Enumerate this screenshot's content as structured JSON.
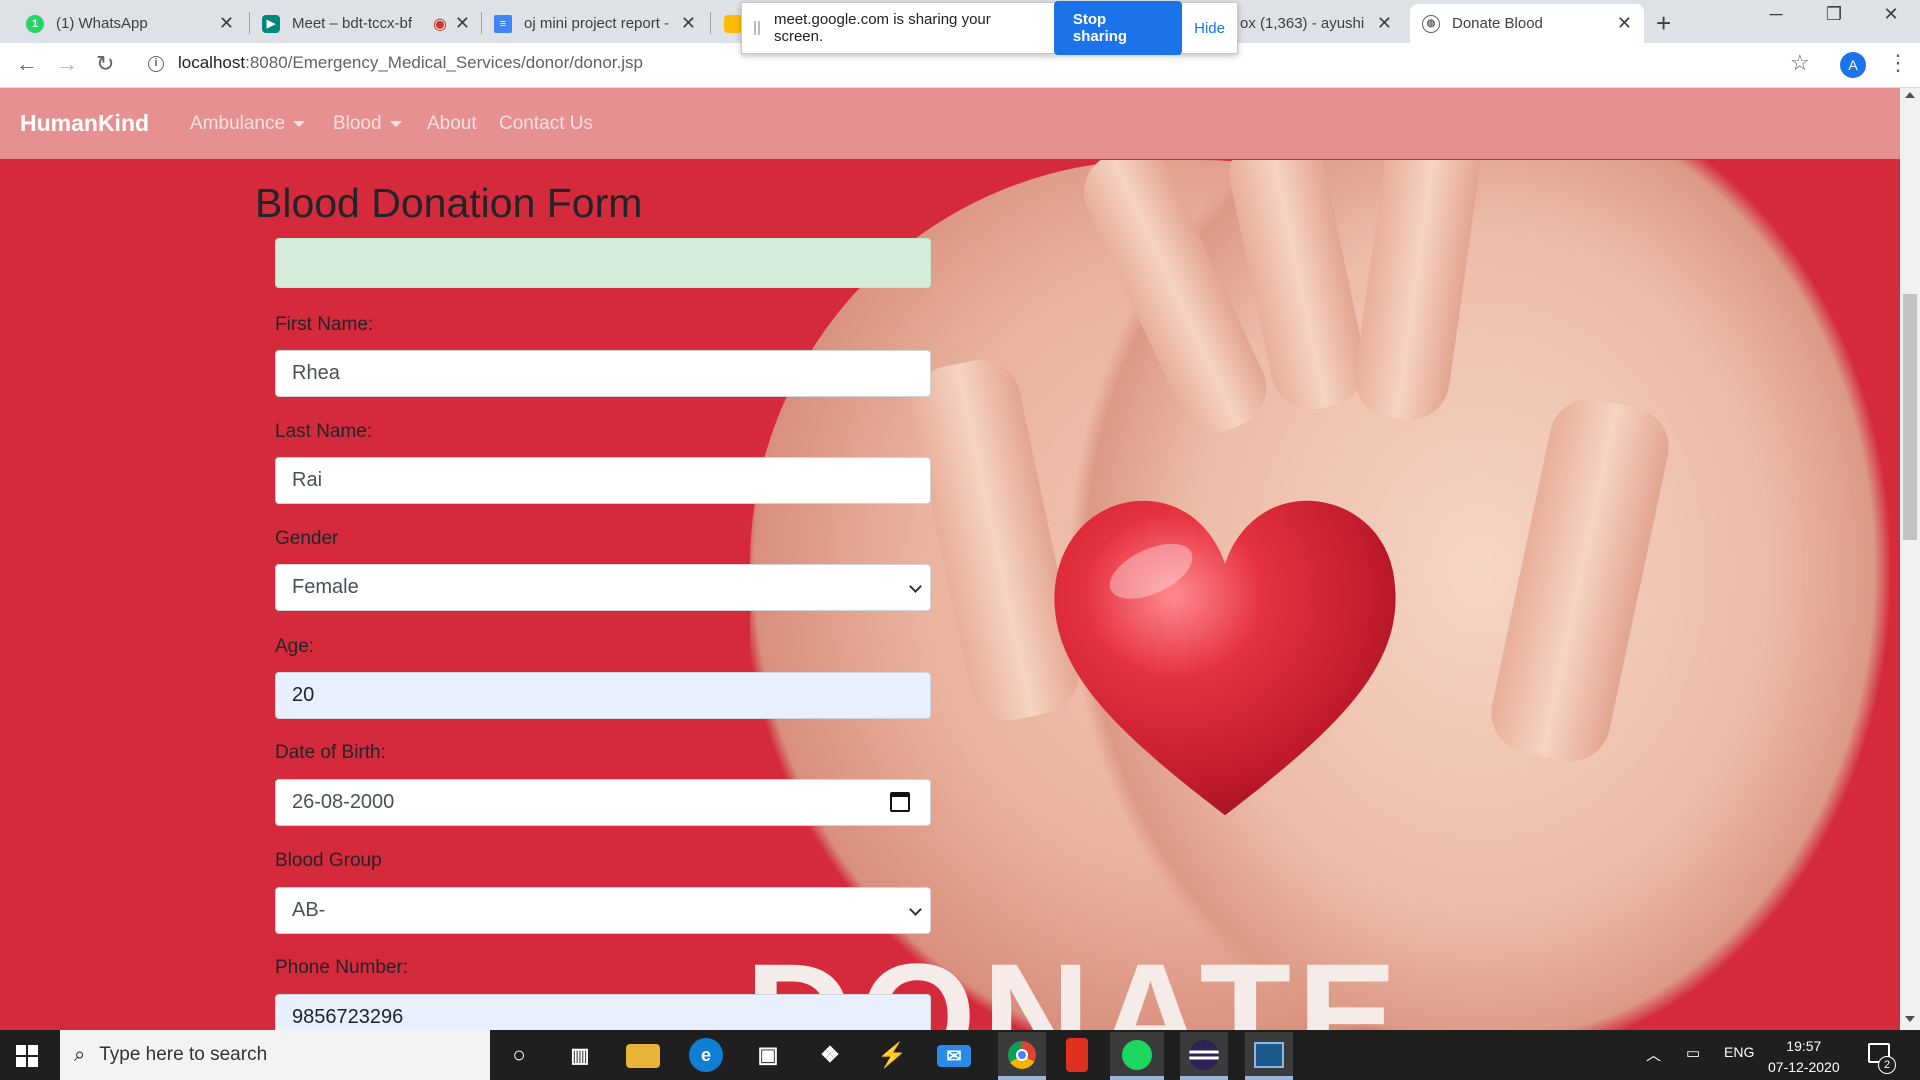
{
  "browser": {
    "tabs": [
      {
        "title": "(1) WhatsApp",
        "icon": "whatsapp-icon",
        "color": "#25d366"
      },
      {
        "title": "Meet – bdt-tccx-bf",
        "icon": "meet-icon",
        "color": "#00897b"
      },
      {
        "title": "oj mini project report -",
        "icon": "docs-icon",
        "color": "#4285f4"
      },
      {
        "title": "ox (1,363) - ayushi",
        "icon": "gmail-icon",
        "color": "#ea4335"
      },
      {
        "title": "Donate Blood",
        "icon": "globe-icon",
        "color": "#5f6368"
      }
    ],
    "url_host": "localhost",
    "url_rest": ":8080/Emergency_Medical_Services/donor/donor.jsp",
    "avatar_letter": "A",
    "share_banner": {
      "message": "meet.google.com is sharing your screen.",
      "stop_label": "Stop sharing",
      "hide_label": "Hide"
    }
  },
  "app": {
    "brand": "HumanKind",
    "nav": [
      {
        "label": "Ambulance",
        "dropdown": true
      },
      {
        "label": "Blood",
        "dropdown": true
      },
      {
        "label": "About",
        "dropdown": false
      },
      {
        "label": "Contact Us",
        "dropdown": false
      }
    ],
    "hero_text": "DONATE",
    "accent_color": "#d42a3c",
    "navbar_color": "#e69091"
  },
  "form": {
    "title": "Blood Donation Form",
    "first_name": {
      "label": "First Name:",
      "value": "Rhea"
    },
    "last_name": {
      "label": "Last Name:",
      "value": "Rai"
    },
    "gender": {
      "label": "Gender",
      "value": "Female"
    },
    "age": {
      "label": "Age:",
      "value": "20"
    },
    "dob": {
      "label": "Date of Birth:",
      "value": "26-08-2000"
    },
    "blood_group": {
      "label": "Blood Group",
      "value": "AB-"
    },
    "phone": {
      "label": "Phone Number:",
      "value": "9856723296"
    }
  },
  "taskbar": {
    "search_placeholder": "Type here to search",
    "language": "ENG",
    "time": "19:57",
    "date": "07-12-2020",
    "notification_count": "2"
  }
}
